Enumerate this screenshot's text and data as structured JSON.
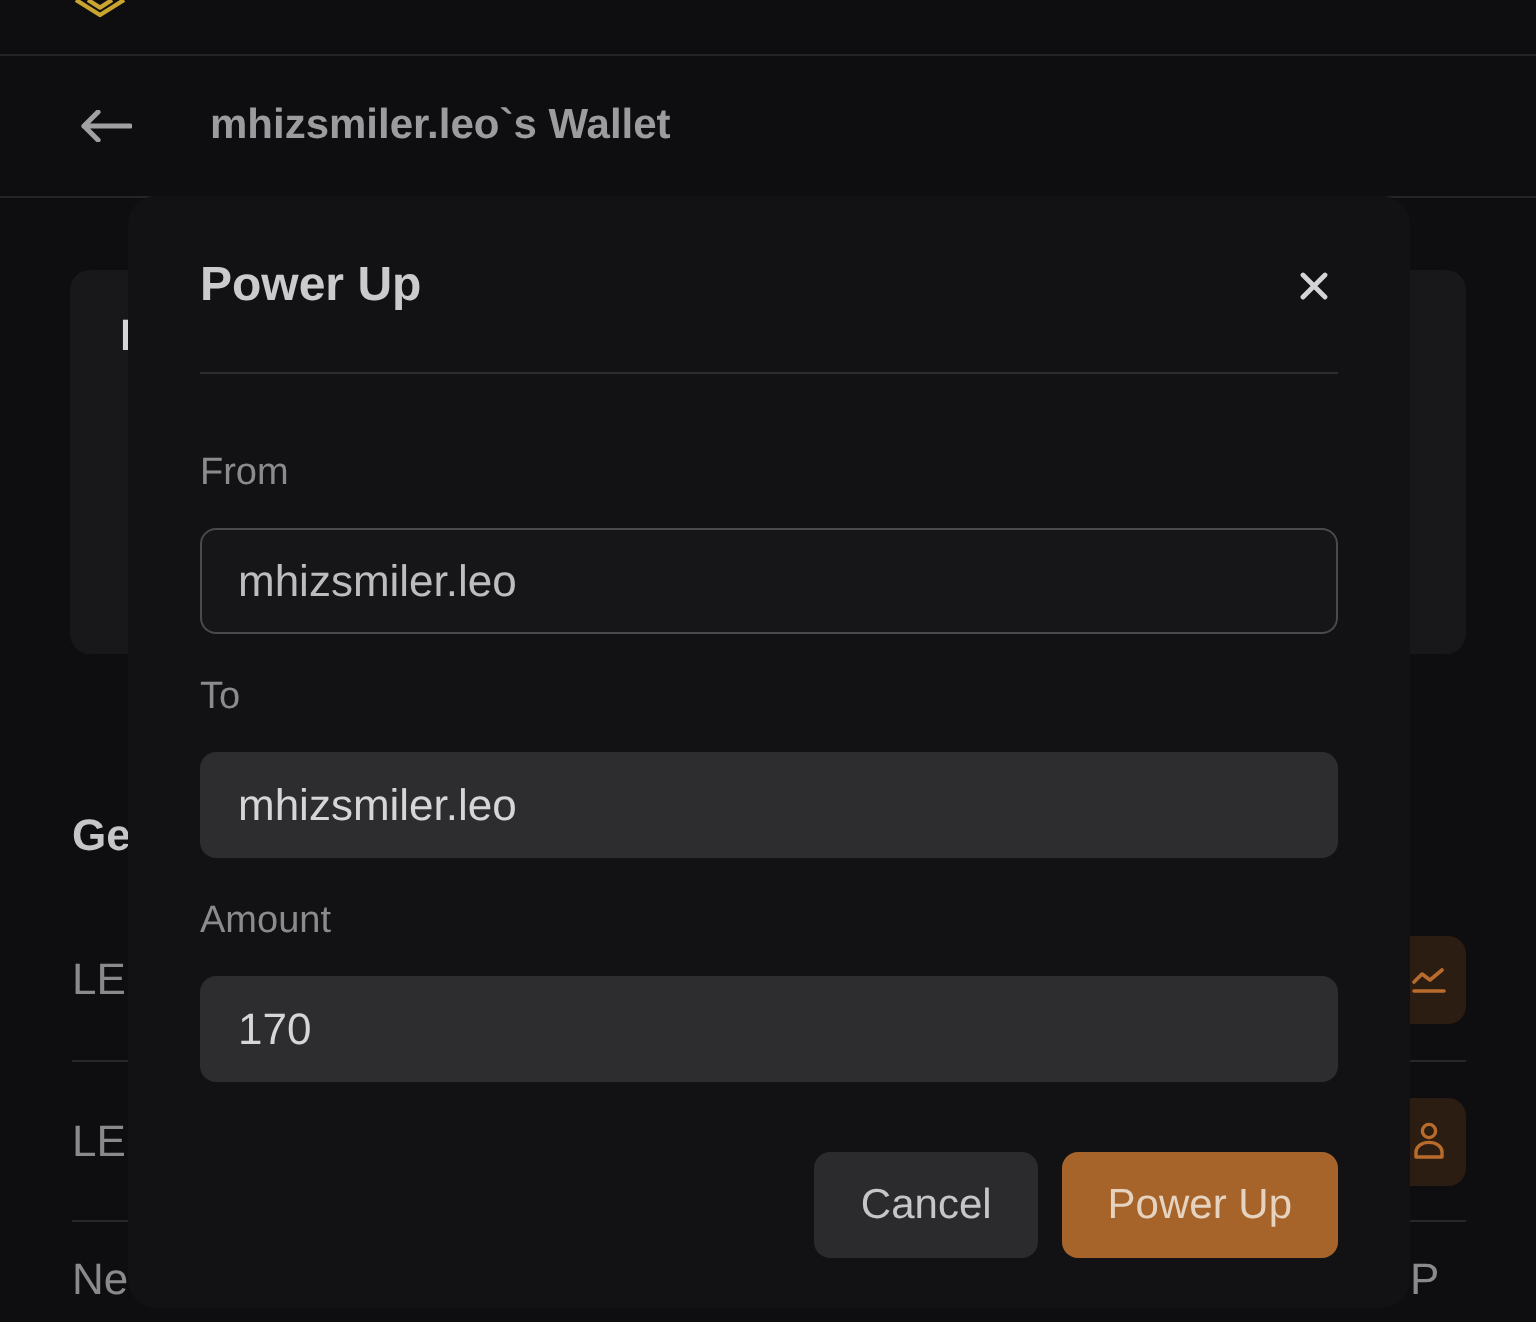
{
  "header": {
    "title": "mhizsmiler.leo`s Wallet"
  },
  "card": {
    "title": "I"
  },
  "section": {
    "heading": "Ge",
    "rows": [
      {
        "label": "LE",
        "kind": "trend"
      },
      {
        "label": "LE",
        "kind": "account"
      },
      {
        "label": "Ne",
        "kind": "value",
        "value": "P"
      }
    ]
  },
  "dialog": {
    "title": "Power Up",
    "fields": [
      {
        "label": "From",
        "value": "mhizsmiler.leo",
        "disabled": true
      },
      {
        "label": "To",
        "value": "mhizsmiler.leo",
        "disabled": false
      },
      {
        "label": "Amount",
        "value": "170",
        "disabled": false
      }
    ],
    "buttons": [
      {
        "label": "Cancel",
        "kind": "secondary"
      },
      {
        "label": "Power Up",
        "kind": "primary"
      }
    ]
  }
}
